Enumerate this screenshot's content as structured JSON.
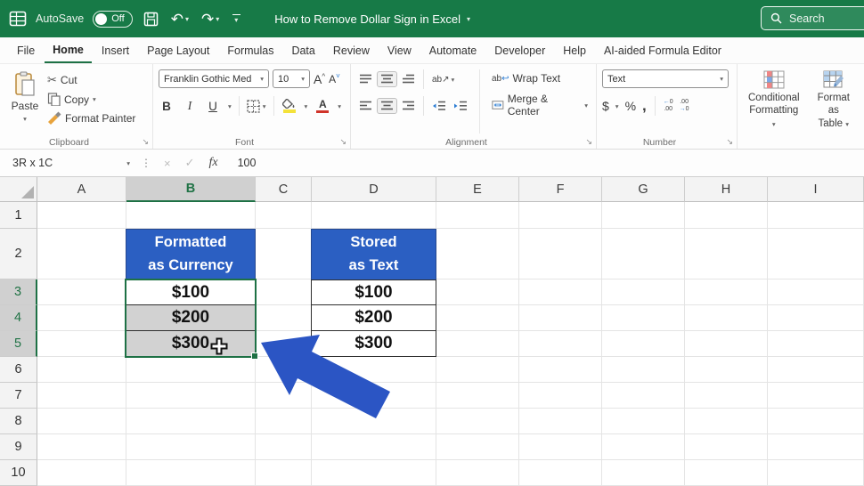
{
  "titlebar": {
    "autosave_label": "AutoSave",
    "autosave_state": "Off",
    "title": "How to Remove Dollar Sign in Excel",
    "search_placeholder": "Search"
  },
  "tabs": {
    "items": [
      "File",
      "Home",
      "Insert",
      "Page Layout",
      "Formulas",
      "Data",
      "Review",
      "View",
      "Automate",
      "Developer",
      "Help",
      "AI-aided Formula Editor"
    ],
    "active": "Home"
  },
  "ribbon": {
    "clipboard": {
      "paste": "Paste",
      "cut": "Cut",
      "copy": "Copy",
      "format_painter": "Format Painter",
      "group_label": "Clipboard"
    },
    "font": {
      "font_name": "Franklin Gothic Med",
      "font_size": "10",
      "bold": "B",
      "italic": "I",
      "underline": "U",
      "increase_size": "A",
      "decrease_size": "A",
      "group_label": "Font"
    },
    "alignment": {
      "orientation": "ab",
      "wrap_text": "Wrap Text",
      "merge_center": "Merge & Center",
      "group_label": "Alignment"
    },
    "number": {
      "format": "Text",
      "currency": "$",
      "percent": "%",
      "comma": ",",
      "group_label": "Number"
    },
    "styles": {
      "conditional_line1": "Conditional",
      "conditional_line2": "Formatting",
      "table_line1": "Format as",
      "table_line2": "Table"
    }
  },
  "formula_bar": {
    "name_box": "3R x 1C",
    "cancel": "×",
    "enter": "✓",
    "fx_label": "fx",
    "formula": "100"
  },
  "grid": {
    "columns": [
      "A",
      "B",
      "C",
      "D",
      "E",
      "F",
      "G",
      "H",
      "I"
    ],
    "rows": [
      "1",
      "2",
      "3",
      "4",
      "5",
      "6",
      "7",
      "8",
      "9",
      "10"
    ],
    "selected_column": "B",
    "selected_rows": [
      "3",
      "4",
      "5"
    ],
    "tables": [
      {
        "column": "B",
        "header_lines": [
          "Formatted",
          "as Currency"
        ],
        "values": [
          "$100",
          "$200",
          "$300"
        ],
        "value_fills": [
          "#ffffff",
          "#d2d2d2",
          "#d2d2d2"
        ]
      },
      {
        "column": "D",
        "header_lines": [
          "Stored",
          "as Text"
        ],
        "values": [
          "$100",
          "$200",
          "$300"
        ],
        "value_fills": [
          "#ffffff",
          "#ffffff",
          "#ffffff"
        ]
      }
    ]
  },
  "colors": {
    "excel_green": "#1e7145",
    "titlebar_green": "#177a47",
    "header_blue": "#2b5fc2",
    "arrow_blue": "#2b55c4",
    "selection_gray": "#d2d2d2"
  }
}
